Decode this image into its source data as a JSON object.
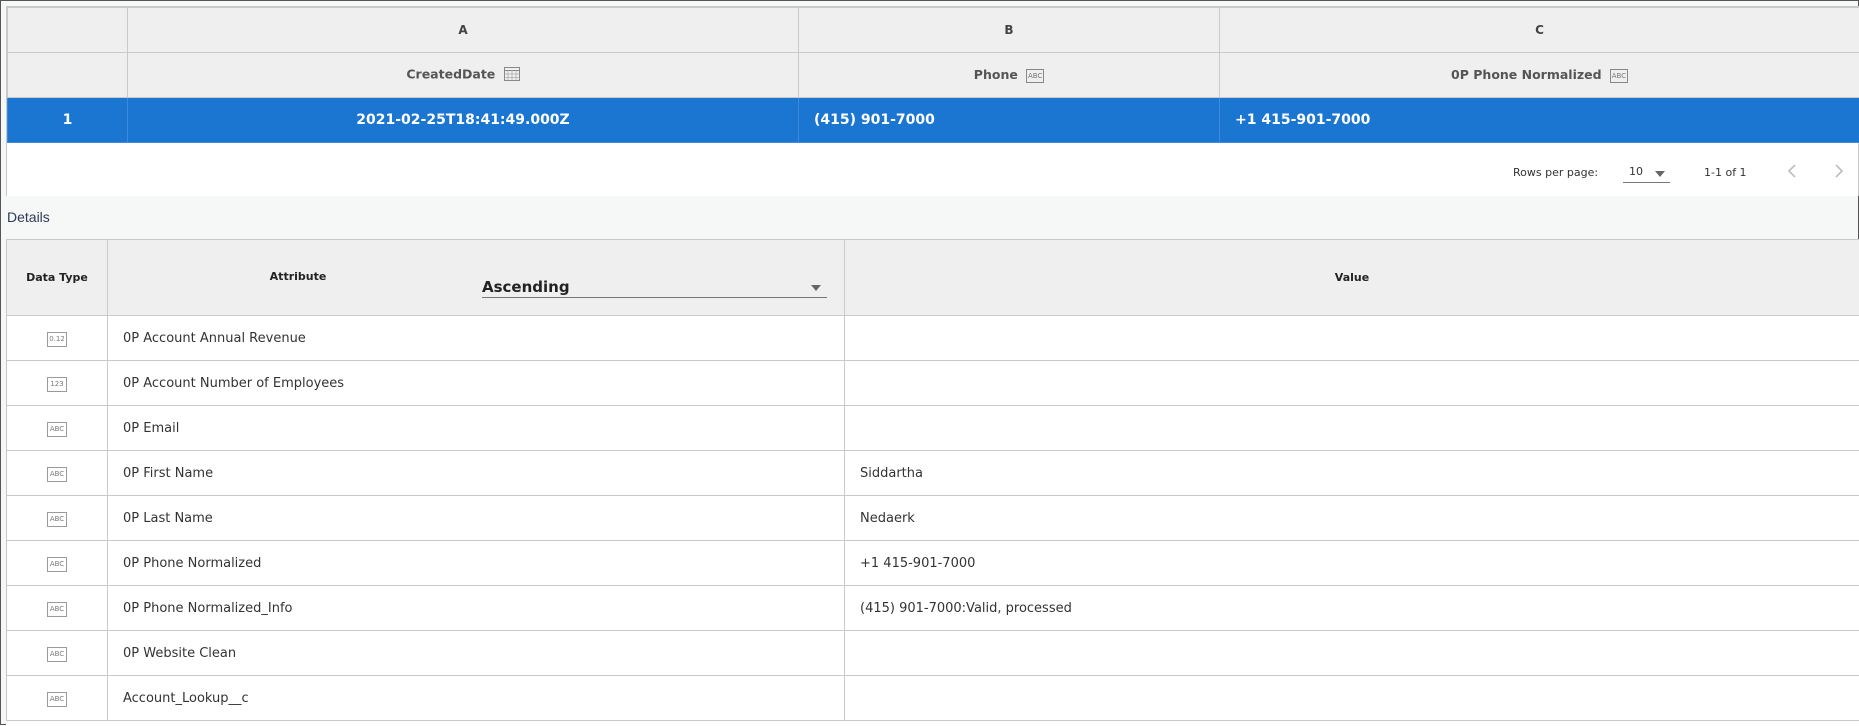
{
  "grid": {
    "columns": [
      {
        "letter": "A",
        "header": "CreatedDate",
        "type_icon": "calendar-icon"
      },
      {
        "letter": "B",
        "header": "Phone",
        "type_icon": "ABC"
      },
      {
        "letter": "C",
        "header": "0P Phone Normalized",
        "type_icon": "ABC"
      }
    ],
    "rows": [
      {
        "index": "1",
        "cells": [
          "2021-02-25T18:41:49.000Z",
          "(415) 901-7000",
          "+1 415-901-7000"
        ]
      }
    ]
  },
  "pagination": {
    "rows_per_page_label": "Rows per page:",
    "rows_per_page_value": "10",
    "range_text": "1-1 of 1",
    "prev_icon": "chevron-left-icon",
    "next_icon": "chevron-right-icon"
  },
  "details": {
    "title": "Details",
    "headers": {
      "data_type": "Data Type",
      "attribute": "Attribute",
      "value": "Value"
    },
    "sort": {
      "value": "Ascending"
    },
    "rows": [
      {
        "type": "0.12",
        "attribute": "0P Account Annual Revenue",
        "value": ""
      },
      {
        "type": "123",
        "attribute": "0P Account Number of Employees",
        "value": ""
      },
      {
        "type": "ABC",
        "attribute": "0P Email",
        "value": ""
      },
      {
        "type": "ABC",
        "attribute": "0P First Name",
        "value": "Siddartha"
      },
      {
        "type": "ABC",
        "attribute": "0P Last Name",
        "value": "Nedaerk"
      },
      {
        "type": "ABC",
        "attribute": "0P Phone Normalized",
        "value": "+1 415-901-7000"
      },
      {
        "type": "ABC",
        "attribute": "0P Phone Normalized_Info",
        "value": "(415) 901-7000:Valid, processed"
      },
      {
        "type": "ABC",
        "attribute": "0P Website Clean",
        "value": ""
      },
      {
        "type": "ABC",
        "attribute": "Account_Lookup__c",
        "value": ""
      }
    ]
  },
  "colors": {
    "selected_row": "#1b76d2",
    "header_bg": "#efefef",
    "details_title": "#2d3b55"
  }
}
